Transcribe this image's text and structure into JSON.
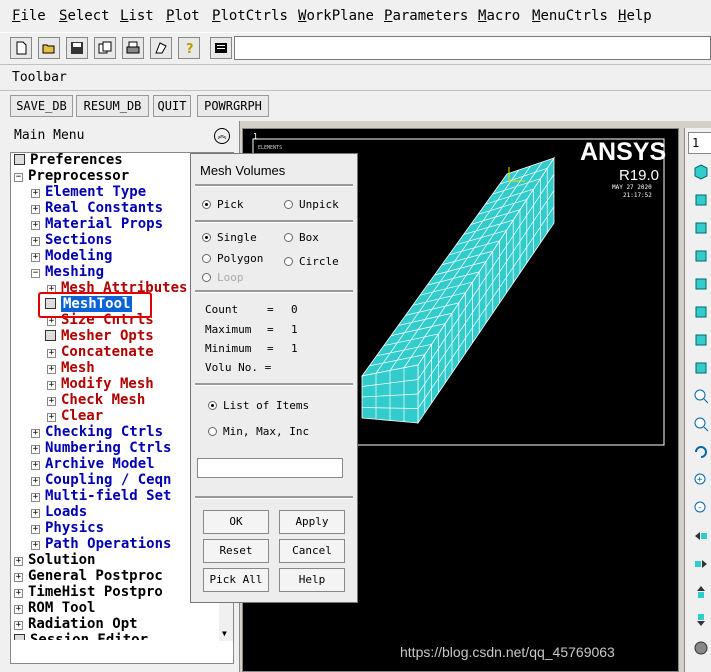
{
  "menubar": {
    "items": [
      "File",
      "Select",
      "List",
      "Plot",
      "PlotCtrls",
      "WorkPlane",
      "Parameters",
      "Macro",
      "MenuCtrls",
      "Help"
    ]
  },
  "toolbar_section": {
    "label": "Toolbar",
    "buttons": [
      "SAVE_DB",
      "RESUM_DB",
      "QUIT",
      "POWRGRPH"
    ]
  },
  "main_menu": {
    "title": "Main Menu",
    "items": [
      "Preferences",
      "Preprocessor",
      "Element Type",
      "Real Constants",
      "Material Props",
      "Sections",
      "Modeling",
      "Meshing",
      "Mesh Attributes",
      "MeshTool",
      "Size Cntrls",
      "Mesher Opts",
      "Concatenate",
      "Mesh",
      "Modify Mesh",
      "Check Mesh",
      "Clear",
      "Checking Ctrls",
      "Numbering Ctrls",
      "Archive Model",
      "Coupling / Ceqn",
      "Multi-field Set",
      "Loads",
      "Physics",
      "Path Operations",
      "Solution",
      "General Postproc",
      "TimeHist Postpro",
      "ROM Tool",
      "Radiation Opt",
      "Session Editor"
    ]
  },
  "graphics": {
    "corner_label": "1",
    "elements_label": "ELEMENTS",
    "brand": "ANSYS",
    "version": "R19.0",
    "date": "MAY 27 2020",
    "time": "21:17:52",
    "mesh_color": "#33cccc"
  },
  "dialog": {
    "title": "Mesh Volumes",
    "pick": "Pick",
    "unpick": "Unpick",
    "single": "Single",
    "box": "Box",
    "polygon": "Polygon",
    "circle": "Circle",
    "loop": "Loop",
    "count_label": "Count",
    "count_value": "0",
    "maximum_label": "Maximum",
    "maximum_value": "1",
    "minimum_label": "Minimum",
    "minimum_value": "1",
    "volu_label": "Volu No. =",
    "list_of_items": "List of Items",
    "min_max_inc": "Min, Max, Inc",
    "buttons": {
      "ok": "OK",
      "apply": "Apply",
      "reset": "Reset",
      "cancel": "Cancel",
      "pick_all": "Pick All",
      "help": "Help"
    }
  },
  "right_toolbar": {
    "view_select": "1"
  },
  "watermark": "https://blog.csdn.net/qq_45769063"
}
